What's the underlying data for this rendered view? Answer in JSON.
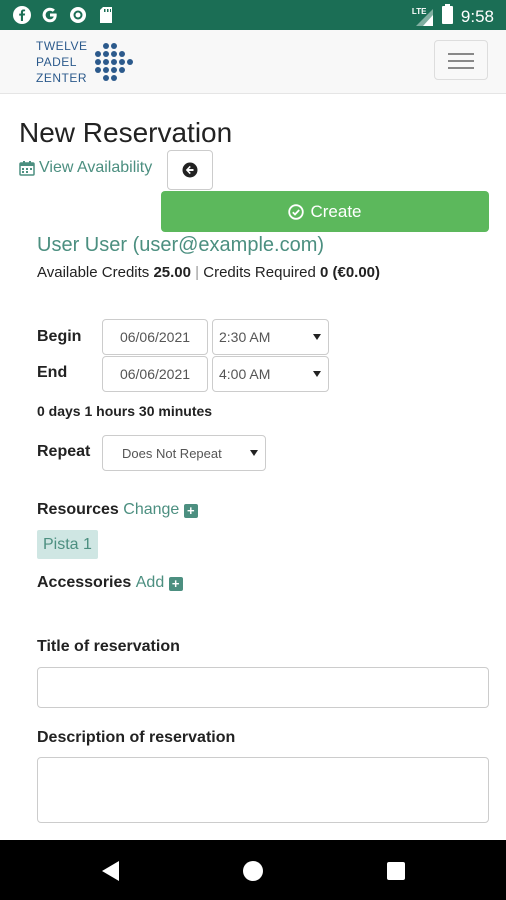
{
  "status_bar": {
    "time": "9:58",
    "network": "LTE",
    "icons": [
      "facebook-icon",
      "google-icon",
      "record-icon",
      "sd-card-icon"
    ]
  },
  "header": {
    "logo_lines": [
      "TWELVE",
      "PADEL",
      "ZENTER"
    ],
    "menu_icon": "hamburger-icon"
  },
  "page": {
    "title": "New Reservation",
    "view_availability": "View Availability",
    "create_label": "Create"
  },
  "user": {
    "name": "User User (user@example.com)",
    "available_credits_label": "Available Credits",
    "available_credits_value": "25.00",
    "separator": "|",
    "credits_required_label": "Credits Required",
    "credits_required_value": "0 (€0.00)"
  },
  "schedule": {
    "begin_label": "Begin",
    "begin_date": "06/06/2021",
    "begin_time": "2:30 AM",
    "end_label": "End",
    "end_date": "06/06/2021",
    "end_time": "4:00 AM",
    "duration": "0 days 1 hours 30 minutes",
    "repeat_label": "Repeat",
    "repeat_value": "Does Not Repeat"
  },
  "resources": {
    "label": "Resources",
    "change_label": "Change",
    "items": [
      "Pista 1"
    ]
  },
  "accessories": {
    "label": "Accessories",
    "add_label": "Add"
  },
  "form": {
    "title_label": "Title of reservation",
    "title_value": "",
    "description_label": "Description of reservation",
    "description_value": ""
  },
  "colors": {
    "status_bar": "#1b6e55",
    "accent": "#4c8f80",
    "create_button": "#5cb85c",
    "logo": "#2c5a8c"
  }
}
